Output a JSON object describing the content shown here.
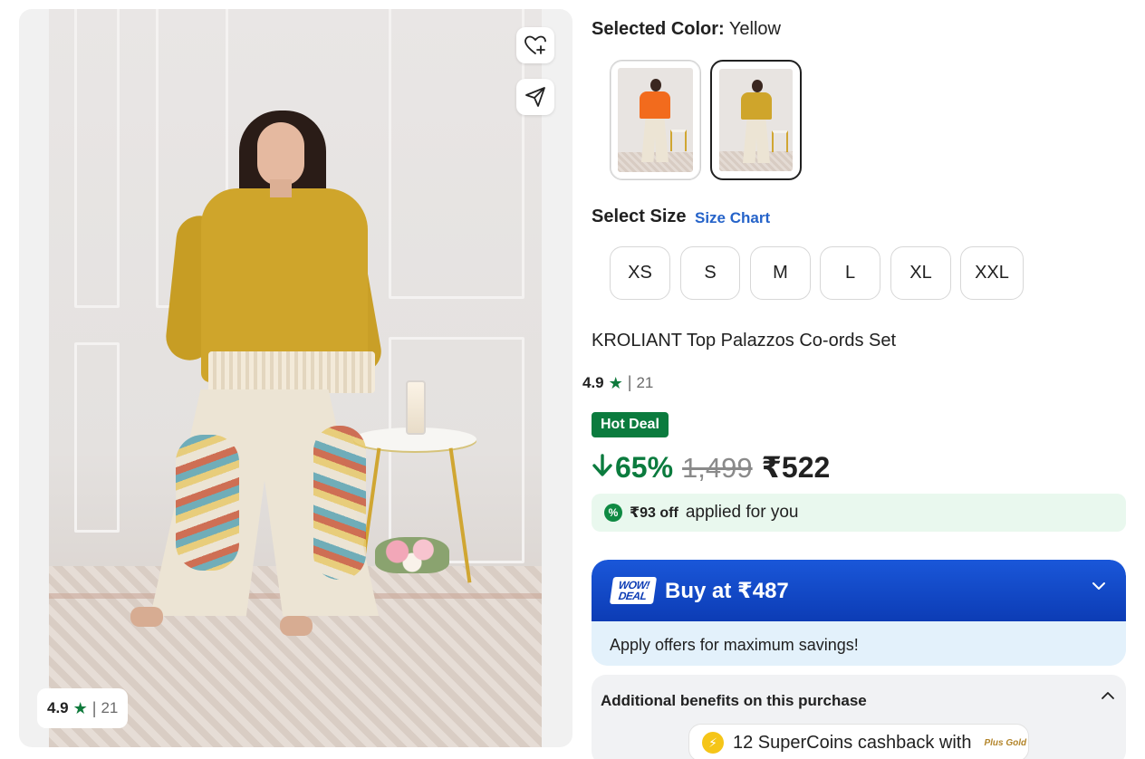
{
  "gallery": {
    "image_alt": "Yellow top palazzos co-ords set",
    "rating": {
      "value": "4.9",
      "separator": "|",
      "count": "21"
    }
  },
  "color": {
    "label": "Selected Color:",
    "value": "Yellow",
    "options": [
      {
        "name": "Orange",
        "color": "#f26b1d"
      },
      {
        "name": "Yellow",
        "color": "#cfa52b"
      }
    ]
  },
  "size": {
    "title": "Select Size",
    "chart_link": "Size Chart",
    "options": [
      "XS",
      "S",
      "M",
      "L",
      "XL",
      "XXL"
    ]
  },
  "product": {
    "title": "KROLIANT Top Palazzos Co-ords Set",
    "rating": {
      "value": "4.9",
      "separator": "|",
      "count": "21"
    },
    "badge": "Hot Deal",
    "discount": "65%",
    "mrp": "1,499",
    "price": "₹522"
  },
  "applied_offer": {
    "amount": "₹93 off",
    "text": "applied for you"
  },
  "wow_deal": {
    "badge_line1": "WOW!",
    "badge_line2": "DEAL",
    "buy_label": "Buy at ₹487",
    "subtitle": "Apply offers for maximum savings!"
  },
  "benefits": {
    "title": "Additional benefits on this purchase",
    "supercoins": "12 SuperCoins cashback with",
    "plus_label": "Plus Gold"
  },
  "colors": {
    "accent_green": "#0b7b3e",
    "wow_blue": "#0c3cb5",
    "size_chart_blue": "#2563c9"
  }
}
